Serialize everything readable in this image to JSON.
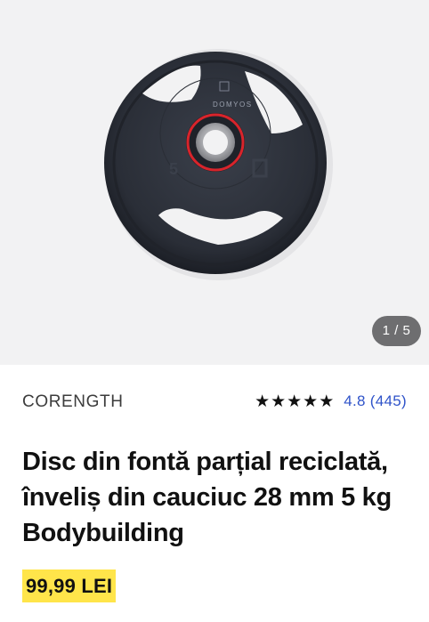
{
  "gallery": {
    "image_alt": "Disc din fontă parțial reciclată",
    "plate_logo_text": "DOMYOS",
    "plate_weight_mark": "5",
    "counter": "1 / 5"
  },
  "product": {
    "brand": "CORENGTH",
    "stars": "★★★★★",
    "rating_text": "4.8 (445)",
    "title": "Disc din fontă parțial reciclată, înveliș din cauciuc 28 mm 5 kg Bodybuilding",
    "price": "99,99 LEI"
  },
  "colors": {
    "price_highlight": "#ffe54a",
    "rating_link": "#2f53c9",
    "plate_ring_red": "#d8242b"
  }
}
